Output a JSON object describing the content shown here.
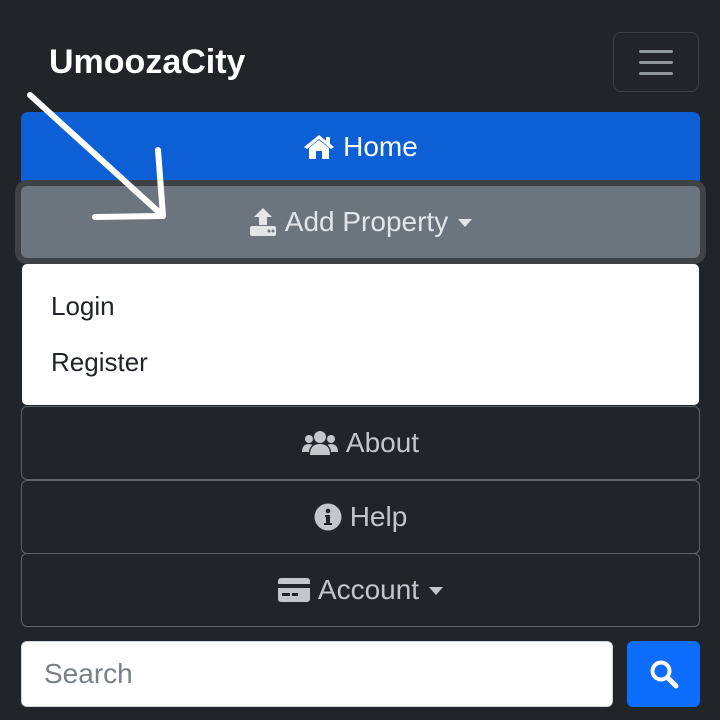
{
  "navbar": {
    "brand": "UmoozaCity",
    "toggler_icon": "hamburger-menu-icon"
  },
  "nav": {
    "home": {
      "label": "Home",
      "icon": "home-icon"
    },
    "add_property": {
      "label": "Add Property",
      "icon": "upload-icon"
    },
    "about": {
      "label": "About",
      "icon": "users-icon"
    },
    "help": {
      "label": "Help",
      "icon": "info-circle-icon"
    },
    "account": {
      "label": "Account",
      "icon": "credit-card-icon"
    }
  },
  "dropdown": {
    "items": [
      {
        "label": "Login"
      },
      {
        "label": "Register"
      }
    ]
  },
  "search": {
    "placeholder": "Search",
    "value": "",
    "button_icon": "search-icon"
  },
  "colors": {
    "background": "#212529",
    "primary": "#0d6efd",
    "home_active": "#0d5fd6",
    "secondary": "#6c757d",
    "annotation_arrow": "#ffffff"
  }
}
